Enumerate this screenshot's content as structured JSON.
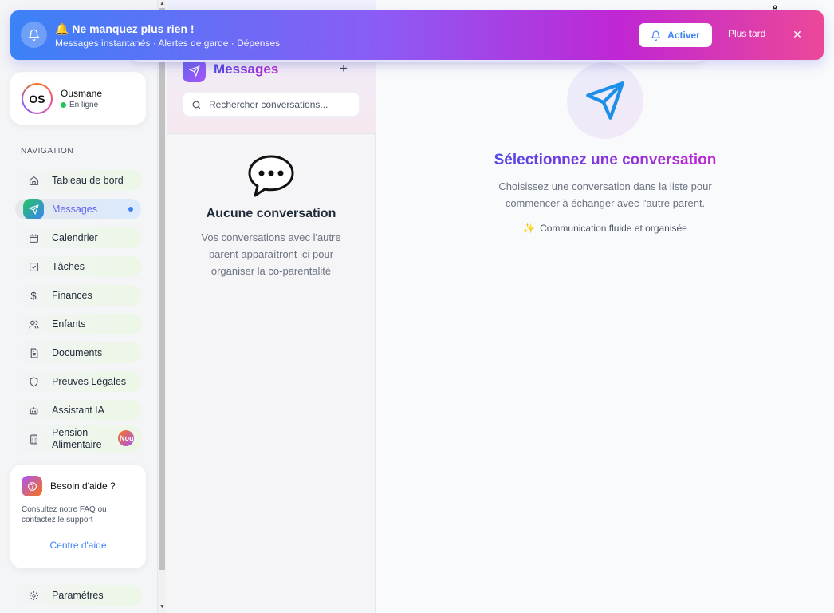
{
  "banner": {
    "title": "🔔 Ne manquez plus rien !",
    "subtitle": "Messages instantanés · Alertes de garde · Dépenses",
    "activate_label": "Activer",
    "later_label": "Plus tard",
    "close_label": "✕"
  },
  "profile": {
    "initials": "OS",
    "name": "Ousmane",
    "status": "En ligne"
  },
  "nav": {
    "heading": "NAVIGATION",
    "items": [
      {
        "label": "Tableau de bord",
        "icon": "home-icon"
      },
      {
        "label": "Messages",
        "icon": "send-icon",
        "active": true
      },
      {
        "label": "Calendrier",
        "icon": "calendar-icon"
      },
      {
        "label": "Tâches",
        "icon": "checkbox-icon"
      },
      {
        "label": "Finances",
        "icon": "dollar-icon"
      },
      {
        "label": "Enfants",
        "icon": "users-icon"
      },
      {
        "label": "Documents",
        "icon": "document-icon"
      },
      {
        "label": "Preuves Légales",
        "icon": "shield-icon"
      },
      {
        "label": "Assistant IA",
        "icon": "bot-icon"
      },
      {
        "label": "Pension Alimentaire",
        "icon": "calculator-icon",
        "badge": "Nouveau"
      }
    ],
    "settings_label": "Paramètres"
  },
  "help": {
    "title": "Besoin d'aide ?",
    "text": "Consultez notre FAQ ou contactez le support",
    "link": "Centre d'aide"
  },
  "conversations": {
    "title": "Messages",
    "add_label": "+",
    "search_placeholder": "Rechercher conversations...",
    "empty_title": "Aucune conversation",
    "empty_text": "Vos conversations avec l'autre parent apparaîtront ici pour organiser la co-parentalité"
  },
  "main": {
    "title": "Sélectionnez une conversation",
    "subtitle": "Choisissez une conversation dans la liste pour commencer à échanger avec l'autre parent.",
    "tag": "Communication fluide et organisée"
  },
  "colors": {
    "accent": "#6366f1",
    "link": "#3b82f6",
    "online": "#22c55e"
  }
}
